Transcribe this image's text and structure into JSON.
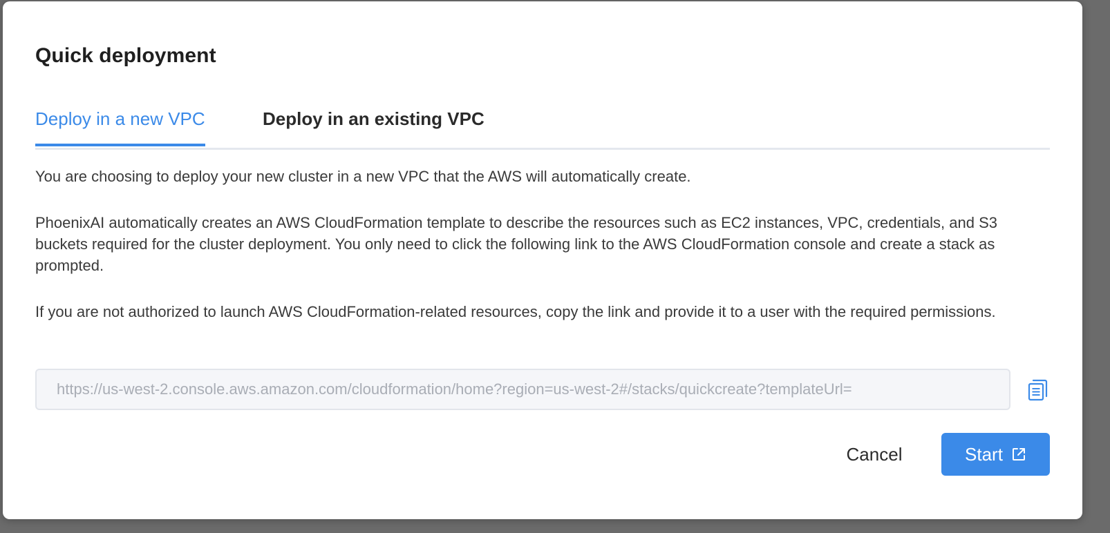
{
  "dialog": {
    "title": "Quick deployment",
    "tabs": [
      {
        "label": "Deploy in a new VPC",
        "active": true
      },
      {
        "label": "Deploy in an existing VPC",
        "active": false
      }
    ],
    "paragraphs": [
      "You are choosing to deploy your new cluster in a new VPC that the AWS will automatically create.",
      "PhoenixAI automatically creates an AWS CloudFormation template to describe the resources such as EC2 instances, VPC, credentials, and S3 buckets required for the cluster deployment. You only need to click the following link to the AWS CloudFormation console and create a stack as prompted.",
      "If you are not authorized to launch AWS CloudFormation-related resources, copy the link and provide it to a user with the required permissions."
    ],
    "link_field": {
      "value": "https://us-west-2.console.aws.amazon.com/cloudformation/home?region=us-west-2#/stacks/quickcreate?templateUrl=",
      "copy_icon": "copy-icon"
    },
    "buttons": {
      "cancel_label": "Cancel",
      "start_label": "Start",
      "start_icon": "external-link-icon"
    }
  },
  "colors": {
    "accent": "#3b8ae8",
    "backdrop": "#6b6b6b",
    "field_bg": "#f5f6f9",
    "field_text": "#a9adb5"
  }
}
